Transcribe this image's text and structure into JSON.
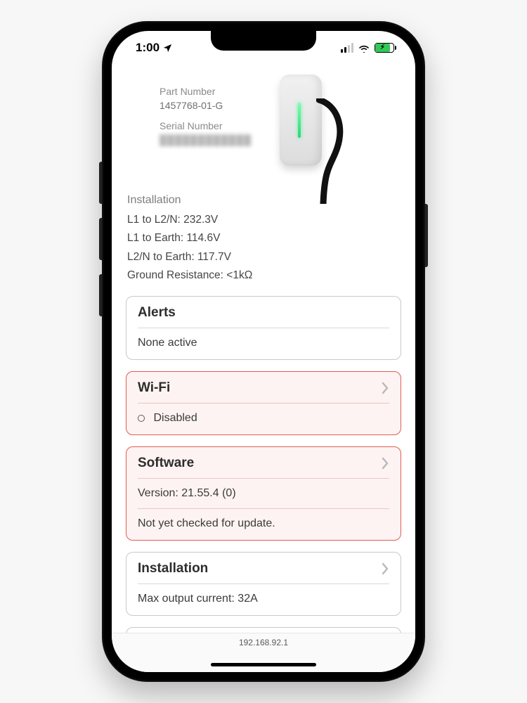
{
  "status_bar": {
    "time": "1:00"
  },
  "device": {
    "part_number_label": "Part Number",
    "part_number_value": "1457768-01-G",
    "serial_number_label": "Serial Number",
    "serial_number_value_masked": "████████████"
  },
  "installation_readings": {
    "title": "Installation",
    "lines": [
      "L1 to L2/N: 232.3V",
      "L1 to Earth: 114.6V",
      "L2/N to Earth: 117.7V",
      "Ground Resistance: <1kΩ"
    ]
  },
  "cards": {
    "alerts": {
      "title": "Alerts",
      "body": "None active"
    },
    "wifi": {
      "title": "Wi-Fi",
      "status": "Disabled"
    },
    "software": {
      "title": "Software",
      "version_line": "Version: 21.55.4 (0)",
      "update_line": "Not yet checked for update."
    },
    "installation": {
      "title": "Installation",
      "line": "Max output current: 32A"
    }
  },
  "bottom": {
    "address": "192.168.92.1"
  }
}
